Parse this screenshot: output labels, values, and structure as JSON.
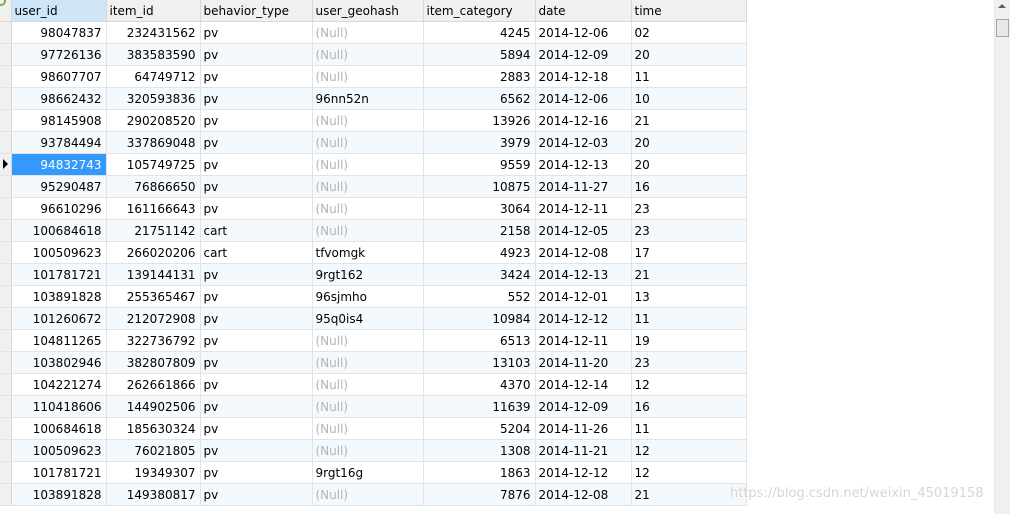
{
  "columns": [
    "user_id",
    "item_id",
    "behavior_type",
    "user_geohash",
    "item_category",
    "date",
    "time"
  ],
  "rows": [
    [
      "98047837",
      "232431562",
      "pv",
      "(Null)",
      "4245",
      "2014-12-06",
      "02"
    ],
    [
      "97726136",
      "383583590",
      "pv",
      "(Null)",
      "5894",
      "2014-12-09",
      "20"
    ],
    [
      "98607707",
      "64749712",
      "pv",
      "(Null)",
      "2883",
      "2014-12-18",
      "11"
    ],
    [
      "98662432",
      "320593836",
      "pv",
      "96nn52n",
      "6562",
      "2014-12-06",
      "10"
    ],
    [
      "98145908",
      "290208520",
      "pv",
      "(Null)",
      "13926",
      "2014-12-16",
      "21"
    ],
    [
      "93784494",
      "337869048",
      "pv",
      "(Null)",
      "3979",
      "2014-12-03",
      "20"
    ],
    [
      "94832743",
      "105749725",
      "pv",
      "(Null)",
      "9559",
      "2014-12-13",
      "20"
    ],
    [
      "95290487",
      "76866650",
      "pv",
      "(Null)",
      "10875",
      "2014-11-27",
      "16"
    ],
    [
      "96610296",
      "161166643",
      "pv",
      "(Null)",
      "3064",
      "2014-12-11",
      "23"
    ],
    [
      "100684618",
      "21751142",
      "cart",
      "(Null)",
      "2158",
      "2014-12-05",
      "23"
    ],
    [
      "100509623",
      "266020206",
      "cart",
      "tfvomgk",
      "4923",
      "2014-12-08",
      "17"
    ],
    [
      "101781721",
      "139144131",
      "pv",
      "9rgt162",
      "3424",
      "2014-12-13",
      "21"
    ],
    [
      "103891828",
      "255365467",
      "pv",
      "96sjmho",
      "552",
      "2014-12-01",
      "13"
    ],
    [
      "101260672",
      "212072908",
      "pv",
      "95q0is4",
      "10984",
      "2014-12-12",
      "11"
    ],
    [
      "104811265",
      "322736792",
      "pv",
      "(Null)",
      "6513",
      "2014-12-11",
      "19"
    ],
    [
      "103802946",
      "382807809",
      "pv",
      "(Null)",
      "13103",
      "2014-11-20",
      "23"
    ],
    [
      "104221274",
      "262661866",
      "pv",
      "(Null)",
      "4370",
      "2014-12-14",
      "12"
    ],
    [
      "110418606",
      "144902506",
      "pv",
      "(Null)",
      "11639",
      "2014-12-09",
      "16"
    ],
    [
      "100684618",
      "185630324",
      "pv",
      "(Null)",
      "5204",
      "2014-11-26",
      "11"
    ],
    [
      "100509623",
      "76021805",
      "pv",
      "(Null)",
      "1308",
      "2014-11-21",
      "12"
    ],
    [
      "101781721",
      "19349307",
      "pv",
      "9rgt16g",
      "1863",
      "2014-12-12",
      "12"
    ],
    [
      "103891828",
      "149380817",
      "pv",
      "(Null)",
      "7876",
      "2014-12-08",
      "21"
    ]
  ],
  "selected_row_index": 6,
  "selected_column_index": 0,
  "highlighted_header_index": 0,
  "watermark": "https://blog.csdn.net/weixin_45019158",
  "colors": {
    "selection": "#3399ff",
    "null_text": "#b4b4b4",
    "alt_row": "#f4f9fe",
    "header_bg": "#f0f0f0"
  }
}
